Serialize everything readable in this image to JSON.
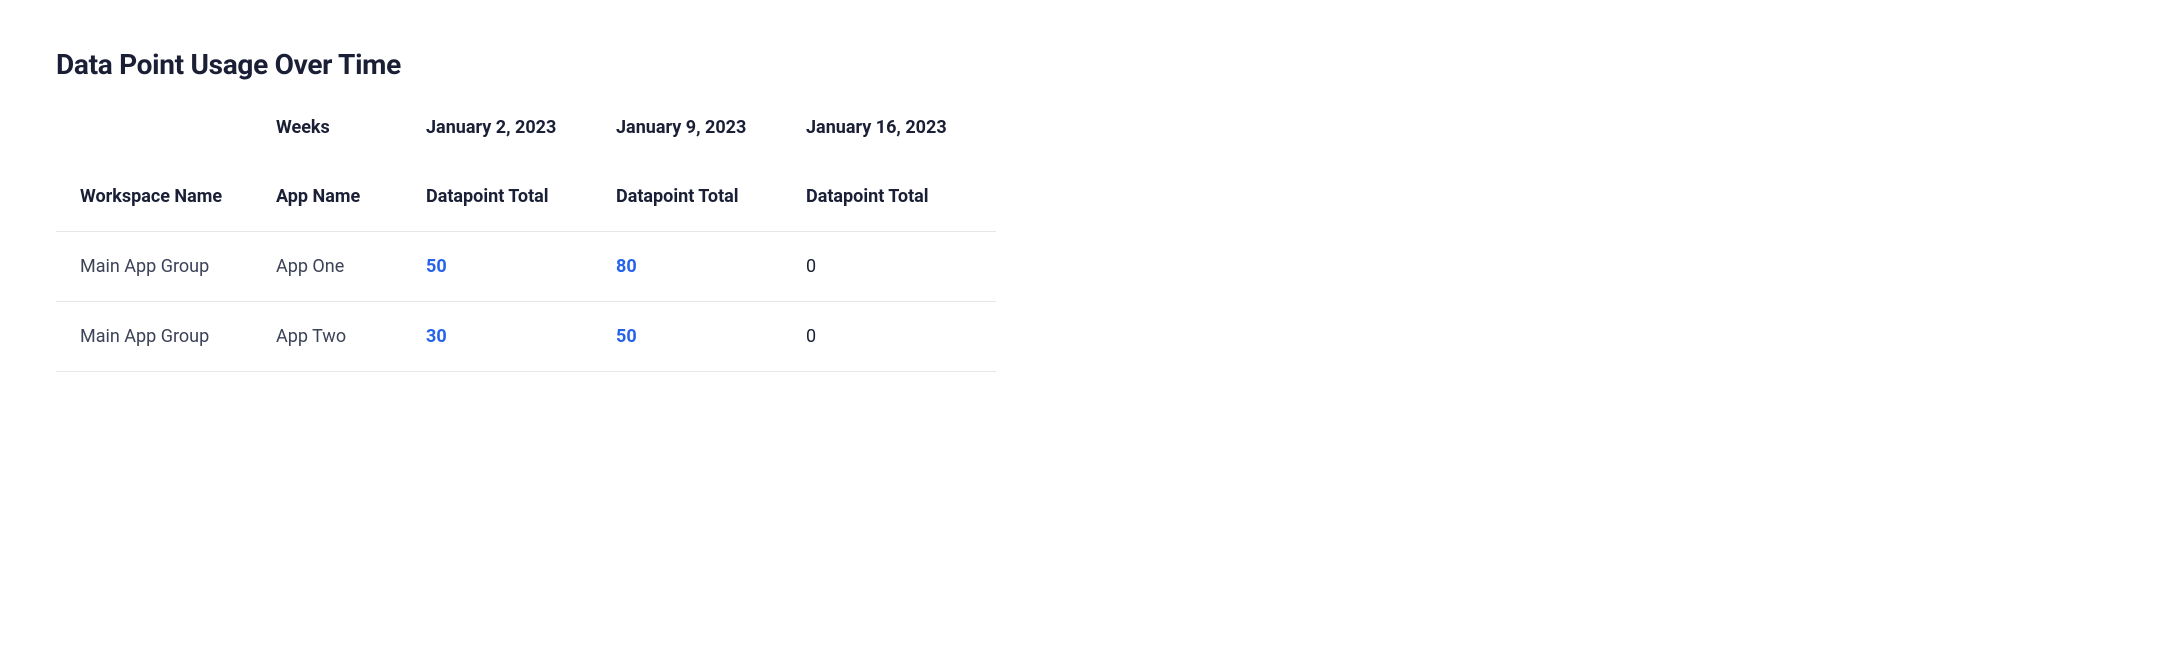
{
  "title": "Data Point Usage Over Time",
  "table": {
    "header_row_1": {
      "blank": "",
      "weeks_label": "Weeks",
      "date_1": "January 2, 2023",
      "date_2": "January 9, 2023",
      "date_3": "January 16, 2023"
    },
    "header_row_2": {
      "workspace": "Workspace Name",
      "app": "App Name",
      "dp_1": "Datapoint Total",
      "dp_2": "Datapoint Total",
      "dp_3": "Datapoint Total"
    },
    "rows": [
      {
        "workspace": "Main App Group",
        "app": "App One",
        "v1": "50",
        "v2": "80",
        "v3": "0"
      },
      {
        "workspace": "Main App Group",
        "app": "App Two",
        "v1": "30",
        "v2": "50",
        "v3": "0"
      }
    ]
  }
}
